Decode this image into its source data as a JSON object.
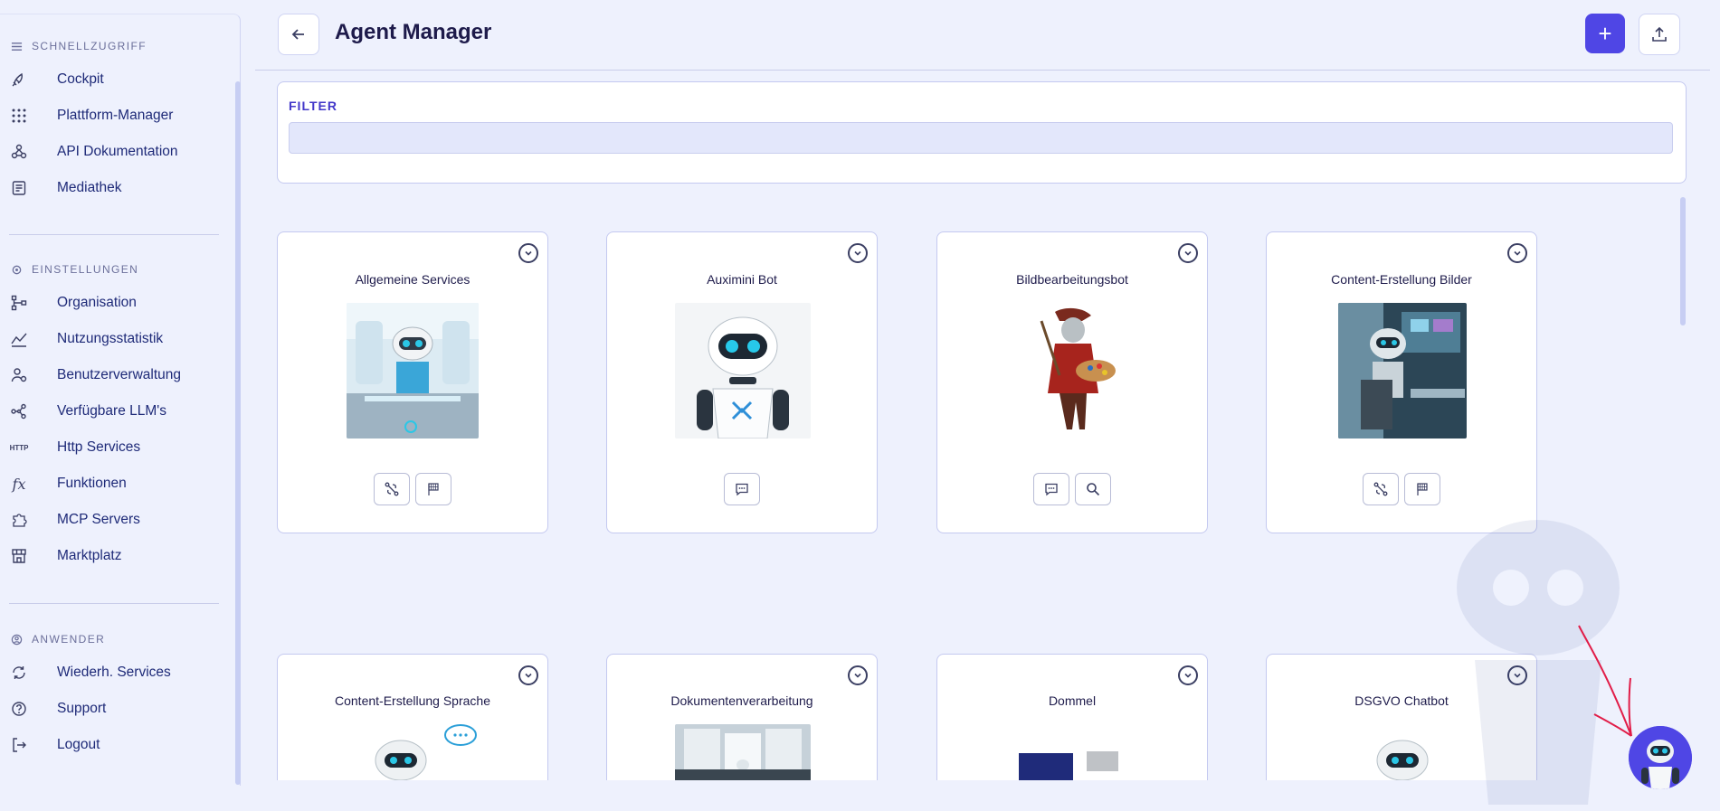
{
  "sidebar": {
    "sections": [
      {
        "label": "SCHNELLZUGRIFF",
        "icon": "menu-icon"
      },
      {
        "label": "EINSTELLUNGEN",
        "icon": "gear-icon"
      },
      {
        "label": "ANWENDER",
        "icon": "user-circle-icon"
      }
    ],
    "items": [
      {
        "label": "Cockpit",
        "icon": "rocket-icon"
      },
      {
        "label": "Plattform-Manager",
        "icon": "grid-icon"
      },
      {
        "label": "API Dokumentation",
        "icon": "webhook-icon"
      },
      {
        "label": "Mediathek",
        "icon": "document-icon"
      },
      {
        "label": "Organisation",
        "icon": "org-chart-icon"
      },
      {
        "label": "Nutzungsstatistik",
        "icon": "chart-icon"
      },
      {
        "label": "Benutzerverwaltung",
        "icon": "users-icon"
      },
      {
        "label": "Verfügbare LLM's",
        "icon": "network-icon"
      },
      {
        "label": "Http Services",
        "icon": "http-icon",
        "icon_text": "HTTP"
      },
      {
        "label": "Funktionen",
        "icon": "function-icon",
        "icon_text": "fx"
      },
      {
        "label": "MCP Servers",
        "icon": "puzzle-icon"
      },
      {
        "label": "Marktplatz",
        "icon": "store-icon"
      },
      {
        "label": "Wiederh. Services",
        "icon": "refresh-icon"
      },
      {
        "label": "Support",
        "icon": "help-icon"
      },
      {
        "label": "Logout",
        "icon": "logout-icon"
      }
    ]
  },
  "header": {
    "title": "Agent Manager",
    "back_icon": "arrow-left-icon",
    "add_label": "+",
    "upload_icon": "upload-icon"
  },
  "filter": {
    "label": "FILTER",
    "value": "",
    "placeholder": ""
  },
  "cards": [
    {
      "title": "Allgemeine Services",
      "actions": [
        "workflow-icon",
        "flag-icon"
      ]
    },
    {
      "title": "Auximini Bot",
      "actions": [
        "chat-icon"
      ]
    },
    {
      "title": "Bildbearbeitungsbot",
      "actions": [
        "chat-icon",
        "search-icon"
      ]
    },
    {
      "title": "Content-Erstellung Bilder",
      "actions": [
        "workflow-icon",
        "flag-icon"
      ]
    },
    {
      "title": "Content-Erstellung Sprache",
      "actions": []
    },
    {
      "title": "Dokumentenverarbeitung",
      "actions": []
    },
    {
      "title": "Dommel",
      "actions": []
    },
    {
      "title": "DSGVO Chatbot",
      "actions": []
    }
  ],
  "colors": {
    "accent": "#4f46e5",
    "background": "#eef1fd",
    "annotation": "#e11d48"
  }
}
